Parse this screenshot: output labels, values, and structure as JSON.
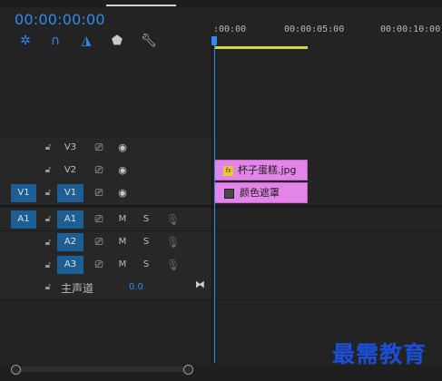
{
  "header": {
    "timecode": "00:00:00:00"
  },
  "ruler": {
    "labels": [
      ":00:00",
      "00:00:05:00",
      "00:00:10:00"
    ]
  },
  "tracks": {
    "video": [
      {
        "target": "V3"
      },
      {
        "target": "V2"
      },
      {
        "source": "V1",
        "target": "V1"
      }
    ],
    "audio": [
      {
        "source": "A1",
        "target": "A1",
        "m": "M",
        "s": "S"
      },
      {
        "target": "A2",
        "m": "M",
        "s": "S"
      },
      {
        "target": "A3",
        "m": "M",
        "s": "S"
      }
    ],
    "master": {
      "label": "主声道",
      "value": "0.0"
    }
  },
  "clips": {
    "v2": {
      "badge": "fx",
      "name": "杯子蛋糕.jpg"
    },
    "v1": {
      "name": "颜色遮罩"
    }
  },
  "watermark": "最需教育",
  "colors": {
    "accent": "#2d8ceb",
    "clip": "#e384e8",
    "track_selected": "#1d5f94",
    "work_area": "#d9d23a"
  },
  "icons": [
    "snap-icon",
    "linked-selection-icon",
    "add-marker-icon",
    "marker-icon",
    "wrench-icon",
    "lock-icon",
    "toggle-output-icon",
    "eye-icon",
    "mic-icon",
    "bowtie-icon"
  ]
}
